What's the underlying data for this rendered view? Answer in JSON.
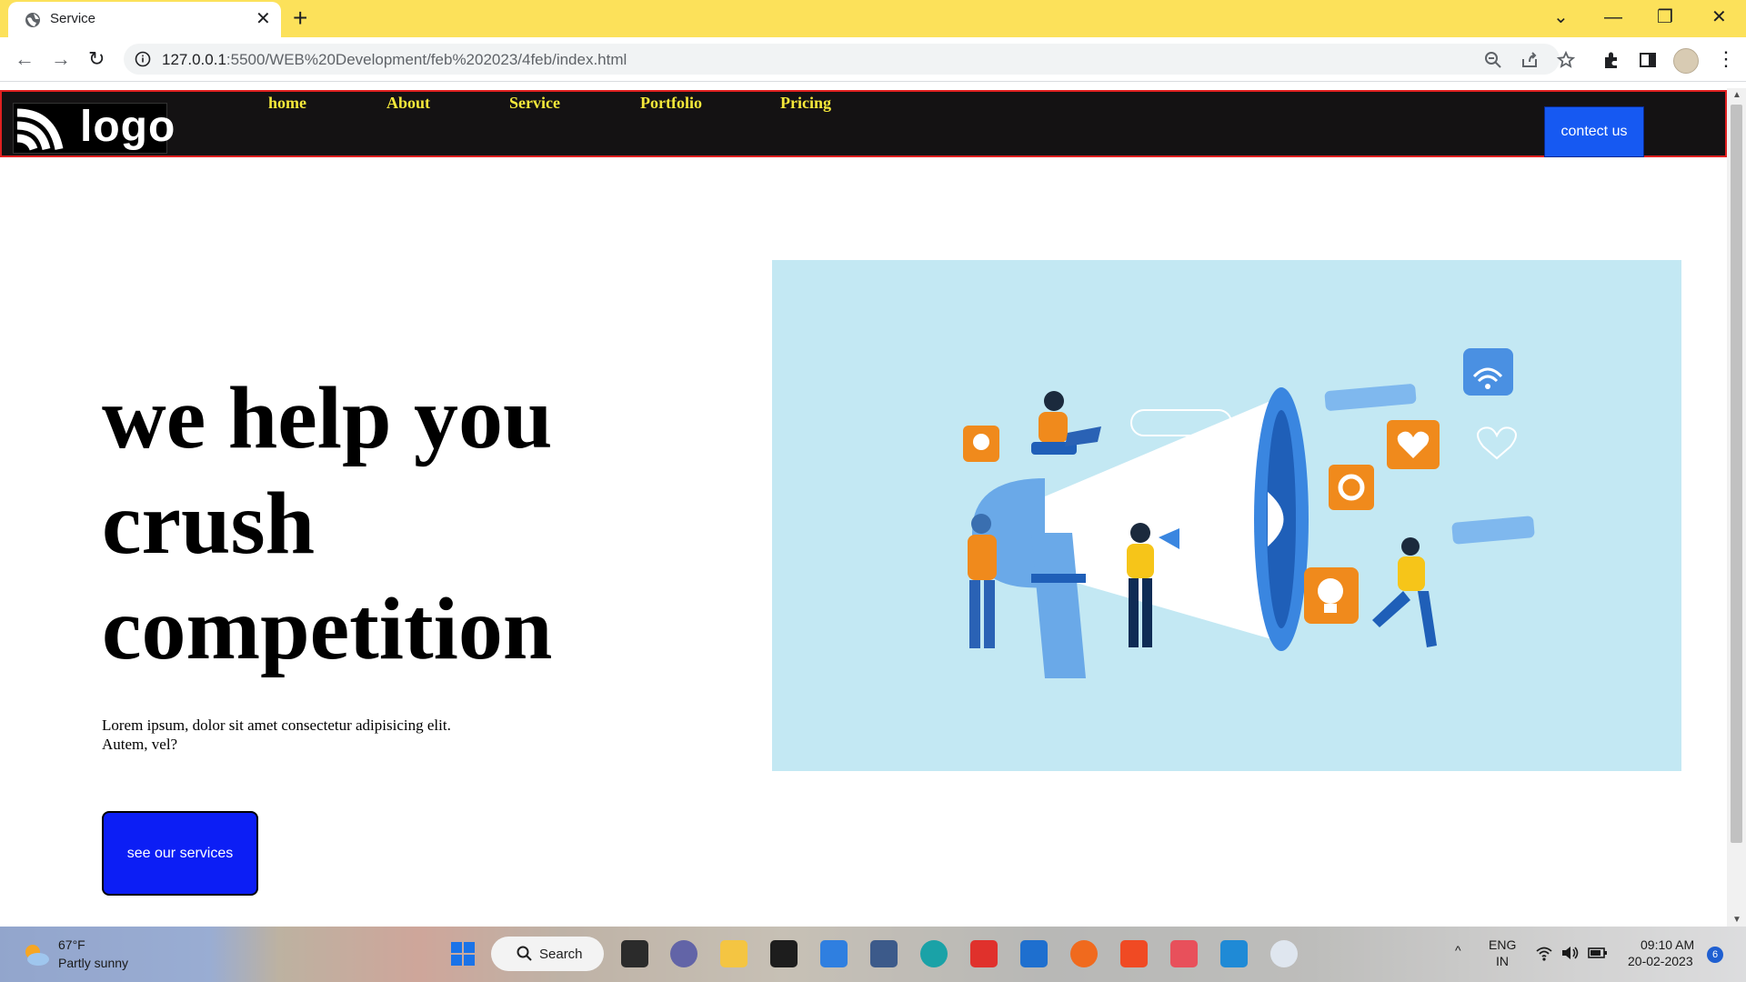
{
  "browser": {
    "tab_title": "Service",
    "tab_close": "✕",
    "new_tab": "+",
    "url_host": "127.0.0.1",
    "url_rest": ":5500/WEB%20Development/feb%202023/4feb/index.html",
    "controls": {
      "list": "⌄",
      "minimize": "—",
      "restore": "❐",
      "close": "✕"
    },
    "nav": {
      "back": "←",
      "forward": "→",
      "reload": "↻"
    },
    "menu": "⋮",
    "accent": "#fce15a"
  },
  "site": {
    "logo_text": "logo",
    "nav_items": [
      {
        "label": "home"
      },
      {
        "label": "About"
      },
      {
        "label": "Service"
      },
      {
        "label": "Portfolio"
      },
      {
        "label": "Pricing"
      }
    ],
    "contact_button": "contect us",
    "hero": {
      "title": "we help you crush competition",
      "text": "Lorem ipsum, dolor sit amet consectetur adipisicing elit. Autem, vel?",
      "button": "see our services"
    },
    "colors": {
      "nav_bg": "#141213",
      "nav_link": "#f4e83a",
      "nav_border": "#e02020",
      "button_blue": "#0c1ef5",
      "contact_blue": "#1659f2",
      "image_bg": "#c3e8f3"
    }
  },
  "taskbar": {
    "weather_temp": "67°F",
    "weather_desc": "Partly sunny",
    "search_label": "Search",
    "lang_top": "ENG",
    "lang_bottom": "IN",
    "time": "09:10 AM",
    "date": "20-02-2023",
    "notifications": "6",
    "apps": [
      "start-icon",
      "task-view-icon",
      "teams-icon",
      "file-explorer-icon",
      "dropbox-icon",
      "todo-icon",
      "snipping-tool-icon",
      "edge-icon",
      "wps-icon",
      "mail-icon",
      "firefox-icon",
      "brave-icon",
      "game-icon",
      "vscode-icon",
      "chrome-icon"
    ]
  }
}
